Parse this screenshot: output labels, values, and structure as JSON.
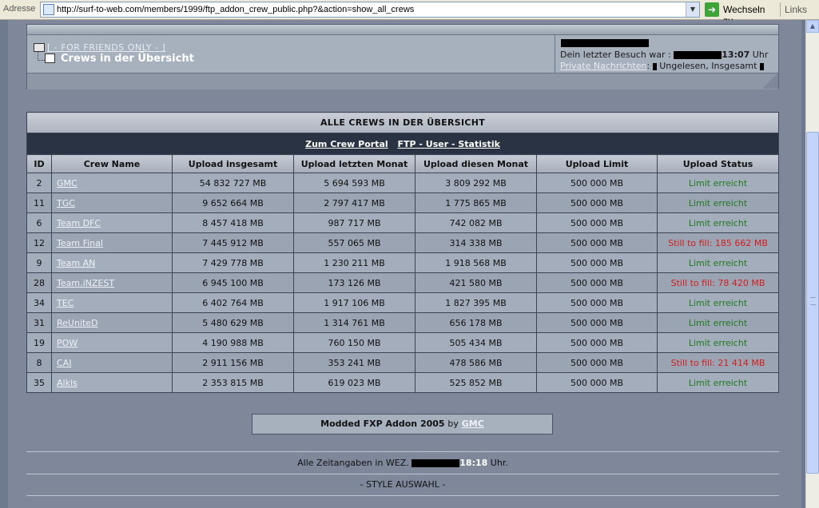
{
  "browser": {
    "address_label": "Adresse",
    "url": "http://surf-to-web.com/members/1999/ftp_addon_crew_public.php?&action=show_all_crews",
    "go_label": "Wechseln zu",
    "links_label": "Links"
  },
  "header": {
    "breadcrumb_link": "[ - FOR FRIENDS ONLY - ]",
    "page_title": "Crews in der Übersicht",
    "last_visit_prefix": "Dein letzter Besuch war :",
    "last_visit_time": "13:07",
    "last_visit_suffix": "Uhr",
    "pm_link": "Private Nachrichten",
    "pm_text": ": ",
    "pm_unread": "Ungelesen, Insgesamt"
  },
  "table": {
    "title": "ALLE CREWS IN DER ÜBERSICHT",
    "nav_links": [
      "Zum Crew Portal",
      "FTP - User - Statistik"
    ],
    "columns": [
      "ID",
      "Crew Name",
      "Upload insgesamt",
      "Upload letzten Monat",
      "Upload diesen Monat",
      "Upload Limit",
      "Upload Status"
    ],
    "rows": [
      {
        "id": "2",
        "name": "GMC",
        "total": "54 832 727 MB",
        "last_month": "5 694 593 MB",
        "this_month": "3 809 292 MB",
        "limit": "500 000 MB",
        "status": "Limit erreicht",
        "reached": true
      },
      {
        "id": "11",
        "name": "TGC",
        "total": "9 652 664 MB",
        "last_month": "2 797 417 MB",
        "this_month": "1 775 865 MB",
        "limit": "500 000 MB",
        "status": "Limit erreicht",
        "reached": true
      },
      {
        "id": "6",
        "name": "Team DFC",
        "total": "8 457 418 MB",
        "last_month": "987 717 MB",
        "this_month": "742 082 MB",
        "limit": "500 000 MB",
        "status": "Limit erreicht",
        "reached": true
      },
      {
        "id": "12",
        "name": "Team Final",
        "total": "7 445 912 MB",
        "last_month": "557 065 MB",
        "this_month": "314 338 MB",
        "limit": "500 000 MB",
        "status": "Still to fill: 185 662 MB",
        "reached": false
      },
      {
        "id": "9",
        "name": "Team AN",
        "total": "7 429 778 MB",
        "last_month": "1 230 211 MB",
        "this_month": "1 918 568 MB",
        "limit": "500 000 MB",
        "status": "Limit erreicht",
        "reached": true
      },
      {
        "id": "28",
        "name": "Team.iNZEST",
        "total": "6 945 100 MB",
        "last_month": "173 126 MB",
        "this_month": "421 580 MB",
        "limit": "500 000 MB",
        "status": "Still to fill: 78 420 MB",
        "reached": false
      },
      {
        "id": "34",
        "name": "TEC",
        "total": "6 402 764 MB",
        "last_month": "1 917 106 MB",
        "this_month": "1 827 395 MB",
        "limit": "500 000 MB",
        "status": "Limit erreicht",
        "reached": true
      },
      {
        "id": "31",
        "name": "ReUniteD",
        "total": "5 480 629 MB",
        "last_month": "1 314 761 MB",
        "this_month": "656 178 MB",
        "limit": "500 000 MB",
        "status": "Limit erreicht",
        "reached": true
      },
      {
        "id": "19",
        "name": "POW",
        "total": "4 190 988 MB",
        "last_month": "760 150 MB",
        "this_month": "505 434 MB",
        "limit": "500 000 MB",
        "status": "Limit erreicht",
        "reached": true
      },
      {
        "id": "8",
        "name": "CAI",
        "total": "2 911 156 MB",
        "last_month": "353 241 MB",
        "this_month": "478 586 MB",
        "limit": "500 000 MB",
        "status": "Still to fill: 21 414 MB",
        "reached": false
      },
      {
        "id": "35",
        "name": "Alkis",
        "total": "2 353 815 MB",
        "last_month": "619 023 MB",
        "this_month": "525 852 MB",
        "limit": "500 000 MB",
        "status": "Limit erreicht",
        "reached": true
      }
    ]
  },
  "footer": {
    "modded_text": "Modded FXP Addon 2005",
    "modded_by": "by",
    "modded_author": "GMC",
    "time_prefix": "Alle Zeitangaben in WEZ.",
    "time_value": "18:18",
    "time_suffix": "Uhr.",
    "style_select": "- STYLE AUSWAHL -"
  },
  "colors": {
    "status_reached": "#1f7a1f",
    "status_fill": "#d41d1d",
    "nav_bar": "#2a3344"
  }
}
